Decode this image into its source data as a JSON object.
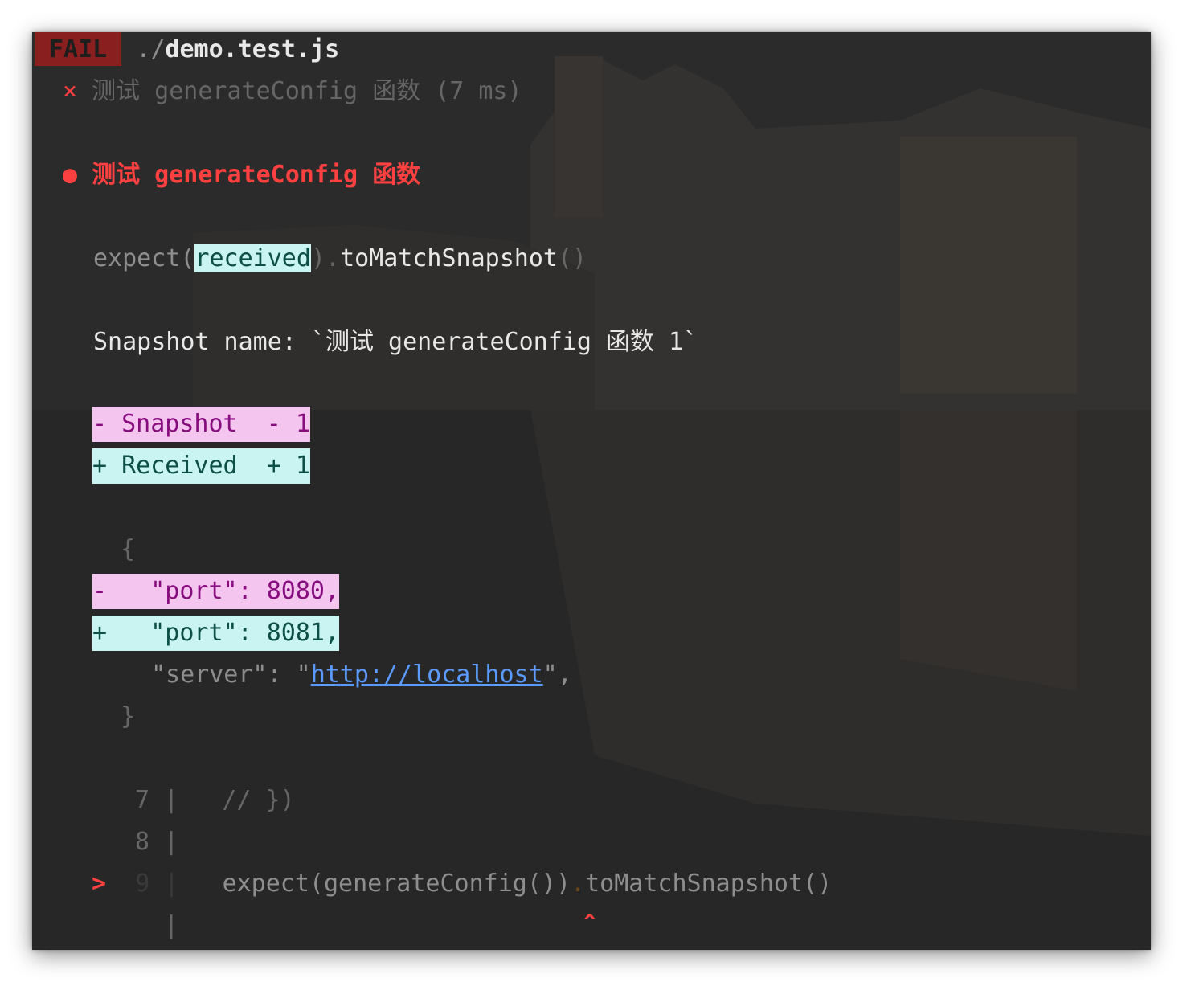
{
  "header": {
    "status_badge": "FAIL",
    "path_prefix": "./",
    "file_name": "demo.test.js"
  },
  "test_result": {
    "mark": "×",
    "summary": "测试 generateConfig 函数 (7 ms)"
  },
  "failure": {
    "bullet": "●",
    "title": "测试 generateConfig 函数"
  },
  "matcher": {
    "prefix": "expect(",
    "received": "received",
    "suffix_dim": ").",
    "method": "toMatchSnapshot",
    "parens": "()"
  },
  "snapshot_name": {
    "label": "Snapshot name: ",
    "value": "`测试 generateConfig 函数 1`"
  },
  "diff_legend": {
    "snapshot": "- Snapshot  - 1",
    "received": "+ Received  + 1"
  },
  "diff_lines": {
    "open_brace": "{",
    "removed": "-   \"port\": 8080,",
    "added": "+   \"port\": 8081,",
    "server_key": "\"server\": \"",
    "server_url": "http://localhost",
    "server_end": "\",",
    "close_brace": "}"
  },
  "code_frame": {
    "line7_num": "7",
    "line7_code": "// })",
    "line8_num": "8",
    "pointer": ">",
    "line9_num": "9",
    "line9_code_a": "expect(generateConfig())",
    "line9_code_dot": ".",
    "line9_code_b": "toMatchSnapshot()",
    "separator": "|",
    "caret": "^"
  },
  "colors": {
    "terminal_bg": "#2a2a2a",
    "fail_badge_bg": "#8a1f1f",
    "error_red": "#ff4040",
    "diff_removed_bg": "#f4c6ef",
    "diff_added_bg": "#c9f4f1",
    "link_blue": "#5b9aff"
  }
}
